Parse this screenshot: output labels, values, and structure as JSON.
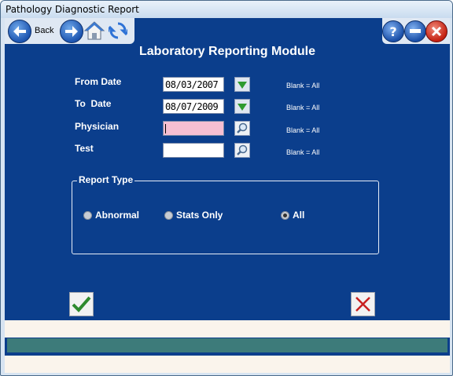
{
  "window": {
    "title": "Pathology Diagnostic Report"
  },
  "toolbar": {
    "back_label": "Back",
    "icons": [
      "back-arrow-icon",
      "forward-arrow-icon",
      "home-icon",
      "refresh-icon",
      "help-icon",
      "minimize-icon",
      "close-icon"
    ]
  },
  "form": {
    "heading": "Laboratory Reporting Module",
    "from_date": {
      "label": "From Date",
      "value": "08/03/2007",
      "hint": "Blank = All"
    },
    "to_date": {
      "label": "To  Date",
      "value": "08/07/2009",
      "hint": "Blank = All"
    },
    "physician": {
      "label": "Physician",
      "value": "",
      "hint": "Blank = All"
    },
    "test": {
      "label": "Test",
      "value": "",
      "hint": "Blank = All"
    }
  },
  "report_type": {
    "title": "Report Type",
    "options": [
      {
        "label": "Abnormal",
        "checked": false
      },
      {
        "label": "Stats Only",
        "checked": false
      },
      {
        "label": "All",
        "checked": true
      }
    ]
  },
  "colors": {
    "panel": "#0b3e8c",
    "status_band": "#3d7b7a",
    "physician_field": "#f7bfd2",
    "ok_check": "#2e8a2e",
    "cancel_x": "#c82020"
  }
}
